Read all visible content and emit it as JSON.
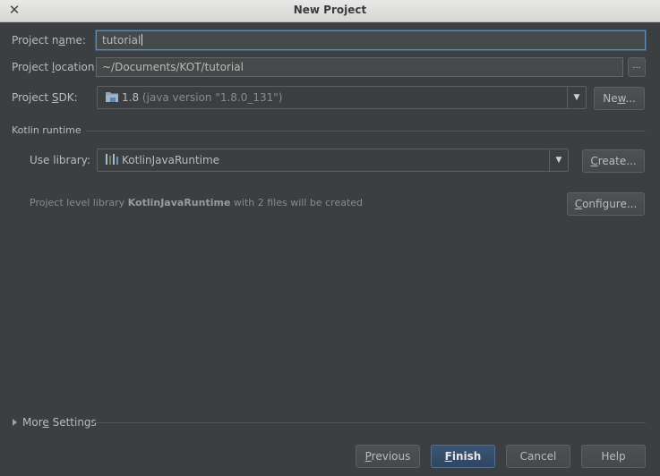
{
  "window": {
    "title": "New Project"
  },
  "project_name": {
    "label_pre": "Project n",
    "label_u": "a",
    "label_post": "me:",
    "value": "tutorial"
  },
  "project_location": {
    "label_pre": "Project ",
    "label_u": "l",
    "label_post": "ocation:",
    "value": "~/Documents/KOT/tutorial",
    "browse_label": "..."
  },
  "project_sdk": {
    "label_pre": "Project ",
    "label_u": "S",
    "label_post": "DK:",
    "version": "1.8",
    "detail": "(java version \"1.8.0_131\")",
    "new_pre": "Ne",
    "new_u": "w",
    "new_post": "..."
  },
  "kotlin_runtime": {
    "section_label": "Kotlin runtime",
    "use_library_label": "Use library:",
    "library_value": "KotlinJavaRuntime",
    "create_pre": "",
    "create_u": "C",
    "create_post": "reate...",
    "note_pre": "Project level library ",
    "note_lib": "KotlinJavaRuntime",
    "note_post": " with 2 files will be created",
    "configure_pre": "",
    "configure_u": "C",
    "configure_post": "onfigure..."
  },
  "more_settings": {
    "pre": "Mor",
    "u": "e",
    "post": " Settings"
  },
  "footer": {
    "previous_pre": "",
    "previous_u": "P",
    "previous_post": "revious",
    "finish_pre": "",
    "finish_u": "F",
    "finish_post": "inish",
    "cancel": "Cancel",
    "help": "Help"
  },
  "icons": {
    "close": "close-icon",
    "folder": "folder-icon",
    "library": "library-icon",
    "dropdown": "chevron-down-icon",
    "expand": "triangle-right-icon"
  },
  "colors": {
    "background": "#3c3f41",
    "field": "#45494a",
    "focus": "#5e8ab5",
    "primary": "#365880"
  }
}
